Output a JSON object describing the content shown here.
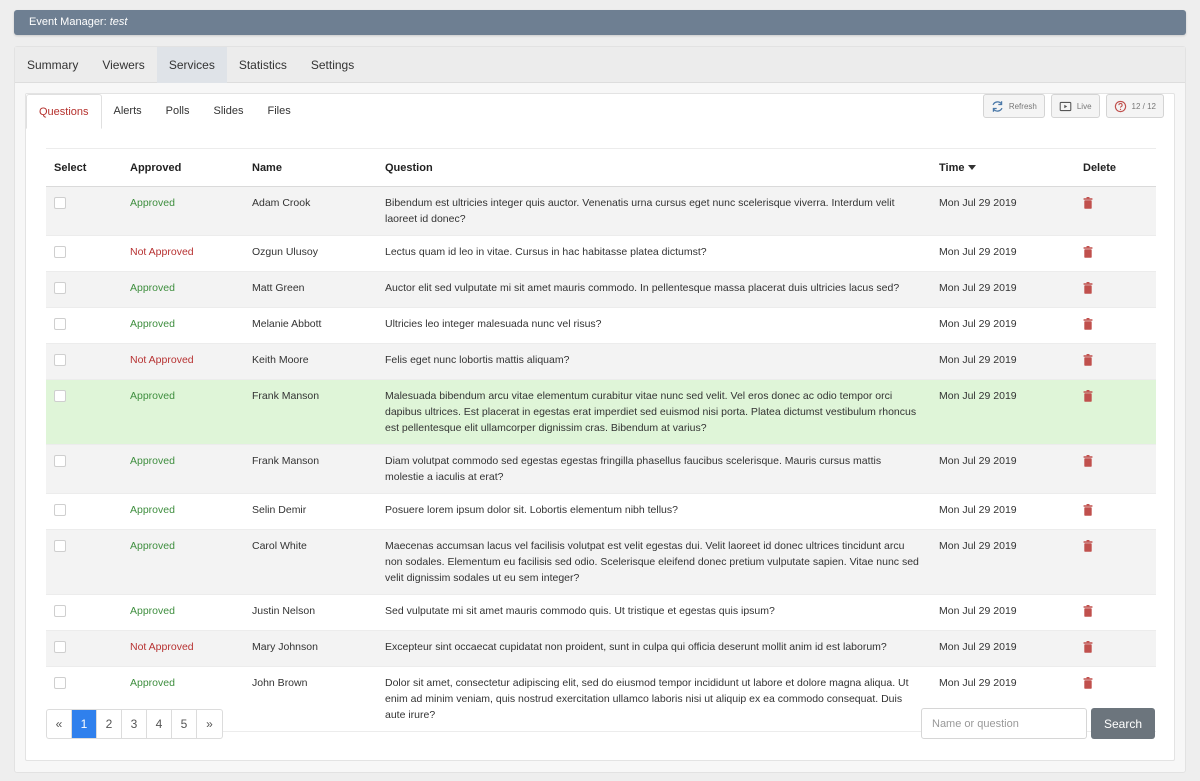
{
  "window": {
    "title_prefix": "Event Manager:",
    "title_name": "test"
  },
  "main_tabs": [
    {
      "label": "Summary"
    },
    {
      "label": "Viewers"
    },
    {
      "label": "Services"
    },
    {
      "label": "Statistics"
    },
    {
      "label": "Settings"
    }
  ],
  "main_active_tab": "Services",
  "sub_tabs": [
    {
      "label": "Questions"
    },
    {
      "label": "Alerts"
    },
    {
      "label": "Polls"
    },
    {
      "label": "Slides"
    },
    {
      "label": "Files"
    }
  ],
  "sub_active_tab": "Questions",
  "toolbar": {
    "refresh_label": "Refresh",
    "live_label": "Live",
    "count_label": "12 / 12"
  },
  "table": {
    "headers": {
      "select": "Select",
      "approved": "Approved",
      "name": "Name",
      "question": "Question",
      "time": "Time",
      "delete": "Delete"
    },
    "rows": [
      {
        "status": "Approved",
        "name": "Adam Crook",
        "question": "Bibendum est ultricies integer quis auctor. Venenatis urna cursus eget nunc scelerisque viverra. Interdum velit laoreet id donec?",
        "time": "Mon Jul 29 2019"
      },
      {
        "status": "Not Approved",
        "name": "Ozgun Ulusoy",
        "question": "Lectus quam id leo in vitae. Cursus in hac habitasse platea dictumst?",
        "time": "Mon Jul 29 2019"
      },
      {
        "status": "Approved",
        "name": "Matt Green",
        "question": "Auctor elit sed vulputate mi sit amet mauris commodo. In pellentesque massa placerat duis ultricies lacus sed?",
        "time": "Mon Jul 29 2019"
      },
      {
        "status": "Approved",
        "name": "Melanie Abbott",
        "question": "Ultricies leo integer malesuada nunc vel risus?",
        "time": "Mon Jul 29 2019"
      },
      {
        "status": "Not Approved",
        "name": "Keith Moore",
        "question": "Felis eget nunc lobortis mattis aliquam?",
        "time": "Mon Jul 29 2019"
      },
      {
        "status": "Approved",
        "name": "Frank Manson",
        "question": "Malesuada bibendum arcu vitae elementum curabitur vitae nunc sed velit. Vel eros donec ac odio tempor orci dapibus ultrices. Est placerat in egestas erat imperdiet sed euismod nisi porta. Platea dictumst vestibulum rhoncus est pellentesque elit ullamcorper dignissim cras. Bibendum at varius?",
        "time": "Mon Jul 29 2019",
        "highlight": true
      },
      {
        "status": "Approved",
        "name": "Frank Manson",
        "question": "Diam volutpat commodo sed egestas egestas fringilla phasellus faucibus scelerisque. Mauris cursus mattis molestie a iaculis at erat?",
        "time": "Mon Jul 29 2019"
      },
      {
        "status": "Approved",
        "name": "Selin Demir",
        "question": "Posuere lorem ipsum dolor sit. Lobortis elementum nibh tellus?",
        "time": "Mon Jul 29 2019"
      },
      {
        "status": "Approved",
        "name": "Carol White",
        "question": "Maecenas accumsan lacus vel facilisis volutpat est velit egestas dui. Velit laoreet id donec ultrices tincidunt arcu non sodales. Elementum eu facilisis sed odio. Scelerisque eleifend donec pretium vulputate sapien. Vitae nunc sed velit dignissim sodales ut eu sem integer?",
        "time": "Mon Jul 29 2019"
      },
      {
        "status": "Approved",
        "name": "Justin Nelson",
        "question": "Sed vulputate mi sit amet mauris commodo quis. Ut tristique et egestas quis ipsum?",
        "time": "Mon Jul 29 2019"
      },
      {
        "status": "Not Approved",
        "name": "Mary Johnson",
        "question": "Excepteur sint occaecat cupidatat non proident, sunt in culpa qui officia deserunt mollit anim id est laborum?",
        "time": "Mon Jul 29 2019"
      },
      {
        "status": "Approved",
        "name": "John Brown",
        "question": "Dolor sit amet, consectetur adipiscing elit, sed do eiusmod tempor incididunt ut labore et dolore magna aliqua. Ut enim ad minim veniam, quis nostrud exercitation ullamco laboris nisi ut aliquip ex ea commodo consequat. Duis aute irure?",
        "time": "Mon Jul 29 2019"
      }
    ]
  },
  "pagination": {
    "prev": "«",
    "next": "»",
    "pages": [
      "1",
      "2",
      "3",
      "4",
      "5"
    ],
    "current": "1"
  },
  "search": {
    "placeholder": "Name or question",
    "value": "",
    "button_label": "Search"
  },
  "colors": {
    "titlebar": "#6e7f92",
    "approved": "#3e8e3e",
    "not_approved": "#b73232",
    "highlight_row": "#dff5d8",
    "active_page": "#2f80ed",
    "delete_icon": "#c0504d"
  },
  "icons": {
    "refresh": "refresh-icon",
    "live": "screen-play-icon",
    "count": "question-circle-icon",
    "delete": "trash-icon",
    "sort": "caret-down-icon"
  }
}
